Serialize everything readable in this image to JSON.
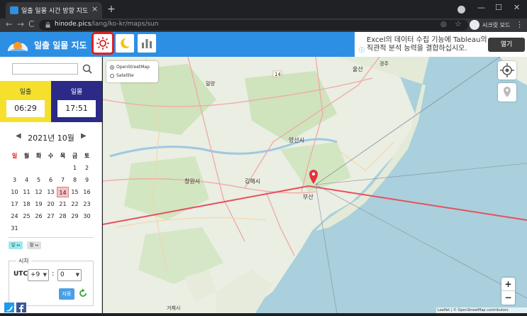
{
  "browser": {
    "tab_title": "일출 일몰 시간 방향 지도",
    "tab_close": "×",
    "new_tab": "+",
    "url_host": "hinode.pics",
    "url_path": "/lang/ko-kr/maps/sun",
    "incognito_label": "시크릿 모드",
    "win_minimize": "—",
    "win_maximize": "☐",
    "win_close": "✕",
    "nav_back": "←",
    "nav_forward": "→",
    "nav_reload": "C",
    "menu": "⋮"
  },
  "header": {
    "title": "일출 일몰 지도",
    "accent": "#2d8fe3",
    "selected_tool": "sun"
  },
  "ad": {
    "line1": "Excel의 데이터 수집 기능에 Tableau의",
    "line2": "직관적 분석 능력을 결합하십시오.",
    "button": "열기",
    "info": "ⓘ"
  },
  "sidebar": {
    "search_placeholder": "",
    "sunrise_label": "일출",
    "sunrise_time": "06:29",
    "sunset_label": "일몰",
    "sunset_time": "17:51",
    "month_label": "2021년 10월",
    "prev": "◀",
    "next": "▶",
    "weekdays": [
      "일",
      "월",
      "화",
      "수",
      "목",
      "금",
      "토"
    ],
    "weeks": [
      [
        "",
        "",
        "",
        "",
        "",
        "1",
        "2"
      ],
      [
        "3",
        "4",
        "5",
        "6",
        "7",
        "8",
        "9"
      ],
      [
        "10",
        "11",
        "12",
        "13",
        "14",
        "15",
        "16"
      ],
      [
        "17",
        "18",
        "19",
        "20",
        "21",
        "22",
        "23"
      ],
      [
        "24",
        "25",
        "26",
        "27",
        "28",
        "29",
        "30"
      ],
      [
        "31",
        "",
        "",
        "",
        "",
        "",
        ""
      ]
    ],
    "today": "14",
    "tag1": "일 ↔",
    "tag2": "월 ↔",
    "tz_legend": "시차",
    "tz_utc": "UTC",
    "tz_hour": "+9",
    "tz_colon": ":",
    "tz_min": "0",
    "tz_auto": "자동"
  },
  "map": {
    "layers": [
      "OpenStreetMap",
      "Satellite"
    ],
    "selected_layer": "OpenStreetMap",
    "zoom_in": "+",
    "zoom_out": "−",
    "attribution": "Leaflet | © OpenStreetMap contributors",
    "places": [
      "울산",
      "양산시",
      "창원시",
      "김해시",
      "부산",
      "거제시",
      "밀양",
      "경주",
      "14"
    ],
    "line_color": "#e8505b"
  }
}
